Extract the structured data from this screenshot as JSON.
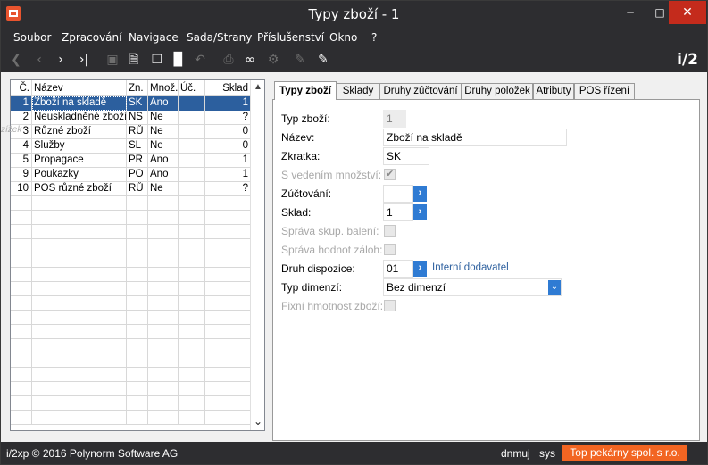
{
  "window": {
    "title": "Typy zboží - 1",
    "min_icon": "minimize-icon",
    "max_icon": "maximize-icon",
    "close_icon": "close-icon"
  },
  "menu": [
    "Soubor",
    "Zpracování",
    "Navigace",
    "Sada/Strany",
    "Příslušenství",
    "Okno",
    "?"
  ],
  "toolbar": {
    "brand": "i/2"
  },
  "grid": {
    "headers": [
      "Č.",
      "Název",
      "Zn.",
      "Množ.",
      "Úč.",
      "Sklad"
    ],
    "rows": [
      [
        "1",
        "Zboží na skladě",
        "SK",
        "Ano",
        "",
        "1"
      ],
      [
        "2",
        "Neuskladněné zboží",
        "NS",
        "Ne",
        "",
        "?"
      ],
      [
        "3",
        "Různé zboží",
        "RŮ",
        "Ne",
        "",
        "0"
      ],
      [
        "4",
        "Služby",
        "SL",
        "Ne",
        "",
        "0"
      ],
      [
        "5",
        "Propagace",
        "PR",
        "Ano",
        "",
        "1"
      ],
      [
        "9",
        "Poukazky",
        "PO",
        "Ano",
        "",
        "1"
      ],
      [
        "10",
        "POS různé zboží",
        "RŮ",
        "Ne",
        "",
        "?"
      ]
    ],
    "selected_row": 0,
    "stray_text": "zížek"
  },
  "tabs": [
    "Typy zboží",
    "Sklady",
    "Druhy zúčtování",
    "Druhy položek",
    "Atributy",
    "POS řízení"
  ],
  "form": {
    "typ_zbozi": {
      "label": "Typ zboží:",
      "value": "1"
    },
    "nazev": {
      "label": "Název:",
      "value": "Zboží na skladě"
    },
    "zkratka": {
      "label": "Zkratka:",
      "value": "SK"
    },
    "s_vedenim": {
      "label": "S vedením množství:",
      "checked": true
    },
    "zuctovani": {
      "label": "Zúčtování:",
      "value": ""
    },
    "sklad": {
      "label": "Sklad:",
      "value": "1"
    },
    "sprava_skup": {
      "label": "Správa skup. balení:",
      "checked": false
    },
    "sprava_hodnot": {
      "label": "Správa hodnot záloh:",
      "checked": false
    },
    "druh_dispozice": {
      "label": "Druh dispozice:",
      "value": "01",
      "description": "Interní dodavatel"
    },
    "typ_dimenzi": {
      "label": "Typ dimenzí:",
      "value": "Bez dimenzí"
    },
    "fixni_hmotnost": {
      "label": "Fixní hmotnost zboží:",
      "checked": false
    }
  },
  "status": {
    "copyright": "i/2xp © 2016 Polynorm Software AG",
    "user": "dnmuj",
    "db": "sys",
    "company": "Top pekárny spol. s r.o.",
    "company_color": "#f26522"
  }
}
